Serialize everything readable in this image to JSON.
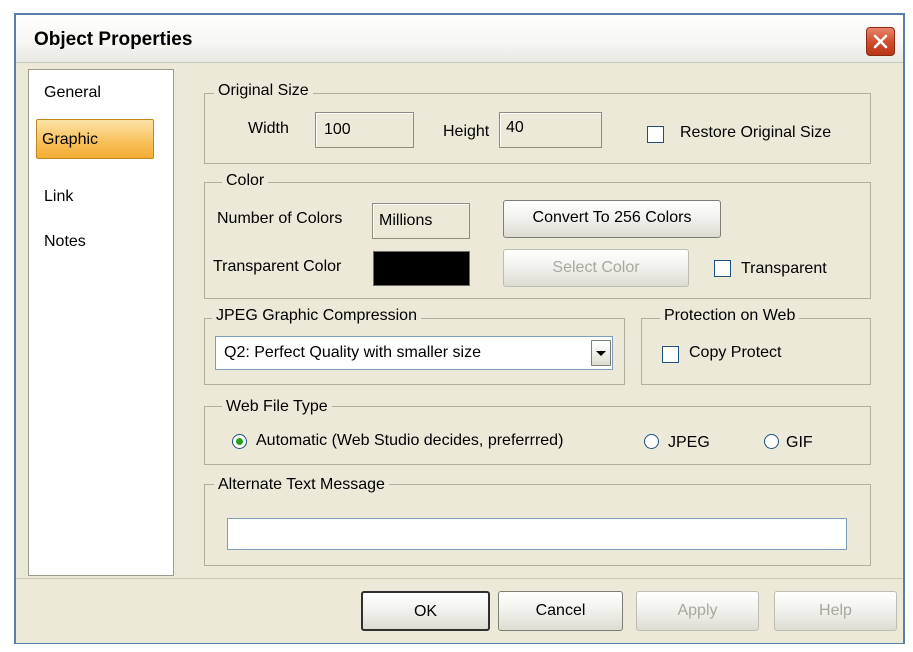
{
  "window": {
    "title": "Object Properties"
  },
  "sidebar": {
    "items": [
      {
        "label": "General"
      },
      {
        "label": "Graphic"
      },
      {
        "label": "Link"
      },
      {
        "label": "Notes"
      }
    ],
    "selected": "Graphic"
  },
  "original_size": {
    "legend": "Original Size",
    "width_label": "Width",
    "width_value": "100",
    "height_label": "Height",
    "height_value": "40",
    "restore_label": "Restore Original Size",
    "restore_checked": false
  },
  "color": {
    "legend": "Color",
    "num_colors_label": "Number of Colors",
    "num_colors_value": "Millions",
    "convert_button": "Convert To 256 Colors",
    "transparent_color_label": "Transparent Color",
    "swatch_color": "#000000",
    "select_color_button": "Select Color",
    "transparent_label": "Transparent",
    "transparent_checked": false
  },
  "jpeg": {
    "legend": "JPEG Graphic Compression",
    "selected": "Q2: Perfect Quality with smaller size"
  },
  "protection": {
    "legend": "Protection on Web",
    "copy_protect_label": "Copy Protect",
    "copy_protect_checked": false
  },
  "web_file_type": {
    "legend": "Web File Type",
    "options": [
      {
        "label": "Automatic (Web Studio decides, preferrred)",
        "selected": true
      },
      {
        "label": "JPEG",
        "selected": false
      },
      {
        "label": "GIF",
        "selected": false
      }
    ]
  },
  "alt_text": {
    "legend": "Alternate Text Message",
    "value": ""
  },
  "footer": {
    "ok": "OK",
    "cancel": "Cancel",
    "apply": "Apply",
    "help": "Help"
  }
}
